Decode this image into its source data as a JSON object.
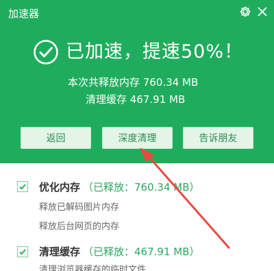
{
  "window": {
    "title": "加速器",
    "gear_icon": "gear-icon",
    "close_icon": "close-icon"
  },
  "status": {
    "icon": "check-circle-icon",
    "headline": "已加速，提速50%！"
  },
  "stats": {
    "freed_label": "本次共释放内存 760.34 MB",
    "cache_label": "清理缓存 467.91 MB"
  },
  "buttons": {
    "back": "返回",
    "deep_clean": "深度清理",
    "tell_friends": "告诉朋友"
  },
  "items": [
    {
      "title": "优化内存",
      "released": "（已释放：760.34 MB）",
      "checked": true,
      "details": [
        "释放已解码图片内存",
        "释放后台网页的内存"
      ]
    },
    {
      "title": "清理缓存",
      "released": "（已释放：467.91 MB）",
      "checked": true,
      "details": [
        "清理浏览器缓存的临时文件"
      ]
    }
  ],
  "colors": {
    "header_green": "#1fad5d",
    "button_bg": "#e4f5e8",
    "accent_green": "#28a860",
    "annotation_arrow": "#e84a3f"
  }
}
